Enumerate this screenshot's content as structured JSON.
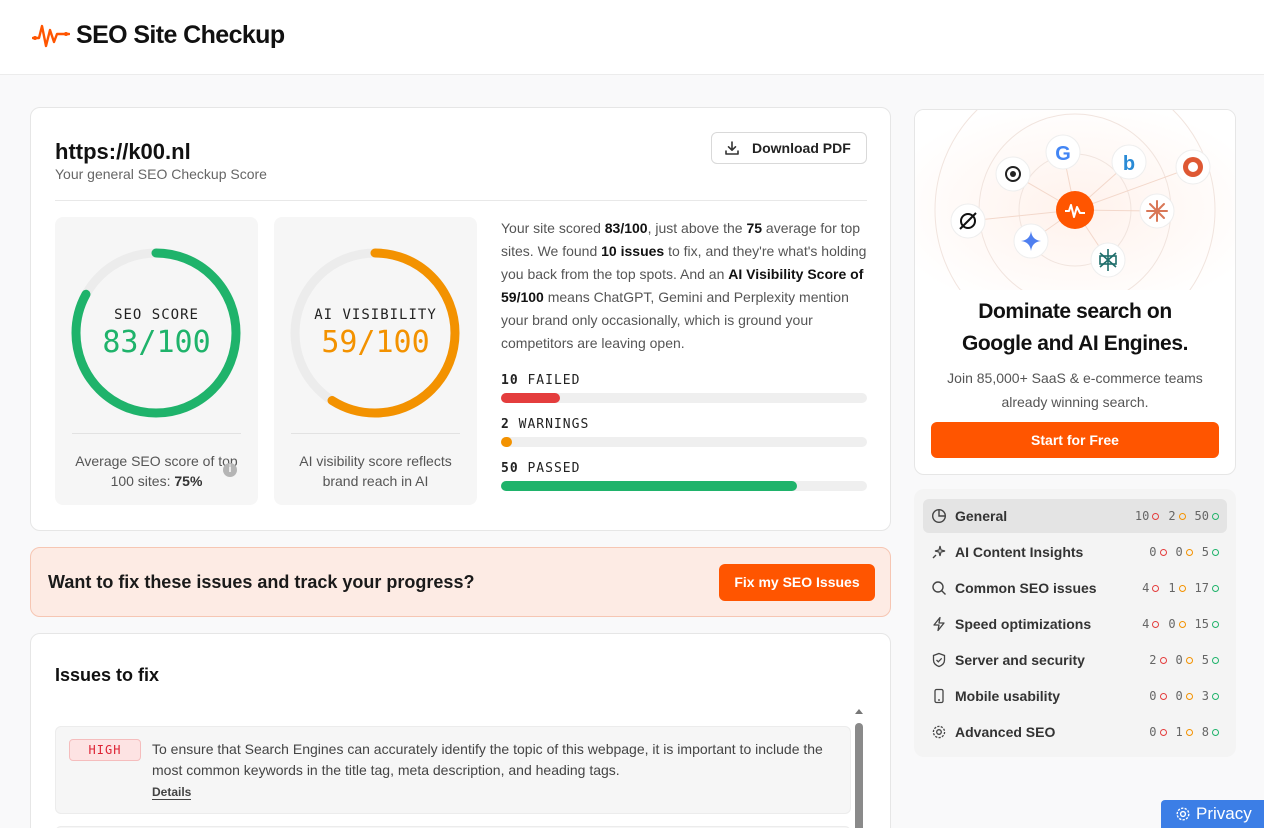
{
  "brand": {
    "name": "SEO Site Checkup",
    "accent": "#ff5500"
  },
  "report": {
    "url": "https://k00.nl",
    "subtitle": "Your general SEO Checkup Score",
    "download_label": "Download PDF"
  },
  "seo_gauge": {
    "label": "SEO SCORE",
    "value_text": "83/100",
    "score": 83,
    "color": "#1fb36b",
    "note_prefix": "Average SEO score of top 100 sites: ",
    "note_value": "75%",
    "info_icon": "info-icon"
  },
  "ai_gauge": {
    "label": "AI VISIBILITY",
    "value_text": "59/100",
    "score": 59,
    "color": "#f39200",
    "note": "AI visibility score reflects brand reach in AI"
  },
  "summary": {
    "t1": "Your site scored ",
    "b1": "83/100",
    "t2": ", just above the ",
    "b2": "75",
    "t3": " average for top sites. We found ",
    "b3": "10 issues",
    "t4": " to fix, and they're what's holding you back from the top spots. And an ",
    "b4": "AI Visibility Score of 59/100",
    "t5": " means ChatGPT, Gemini and Perplexity mention your brand only occasionally, which is ground your competitors are leaving open."
  },
  "results": [
    {
      "count": "10",
      "label": "FAILED",
      "fraction": 0.16,
      "color": "#e43d3d"
    },
    {
      "count": "2",
      "label": "WARNINGS",
      "fraction": 0.03,
      "color": "#f39200"
    },
    {
      "count": "50",
      "label": "PASSED",
      "fraction": 0.81,
      "color": "#1fb36b"
    }
  ],
  "cta": {
    "text": "Want to fix these issues and track your progress?",
    "button": "Fix my SEO Issues"
  },
  "issues": {
    "title": "Issues to fix",
    "items": [
      {
        "severity": "HIGH",
        "text": "To ensure that Search Engines can accurately identify the topic of this webpage, it is important to include the most common keywords in the title tag, meta description, and heading tags.",
        "details": "Details"
      }
    ]
  },
  "promo": {
    "title_line1": "Dominate search on",
    "title_line2": "Google and AI Engines.",
    "sub": "Join 85,000+ SaaS & e-commerce teams already winning search.",
    "button": "Start for Free",
    "icons": [
      "chatgpt-icon",
      "google-icon",
      "bing-icon",
      "duckduckgo-icon",
      "perplexity-icon",
      "gemini-icon",
      "claude-icon",
      "grok-icon",
      "seo-site-checkup-icon"
    ]
  },
  "categories": [
    {
      "label": "General",
      "icon": "pie-chart-icon",
      "failed": "10",
      "warnings": "2",
      "passed": "50",
      "active": true
    },
    {
      "label": "AI Content Insights",
      "icon": "sparkles-icon",
      "failed": "0",
      "warnings": "0",
      "passed": "5"
    },
    {
      "label": "Common SEO issues",
      "icon": "search-icon",
      "failed": "4",
      "warnings": "1",
      "passed": "17"
    },
    {
      "label": "Speed optimizations",
      "icon": "bolt-icon",
      "failed": "4",
      "warnings": "0",
      "passed": "15"
    },
    {
      "label": "Server and security",
      "icon": "shield-icon",
      "failed": "2",
      "warnings": "0",
      "passed": "5"
    },
    {
      "label": "Mobile usability",
      "icon": "mobile-icon",
      "failed": "0",
      "warnings": "0",
      "passed": "3"
    },
    {
      "label": "Advanced SEO",
      "icon": "gear-icon",
      "failed": "0",
      "warnings": "1",
      "passed": "8"
    }
  ],
  "privacy": {
    "label": "Privacy"
  }
}
